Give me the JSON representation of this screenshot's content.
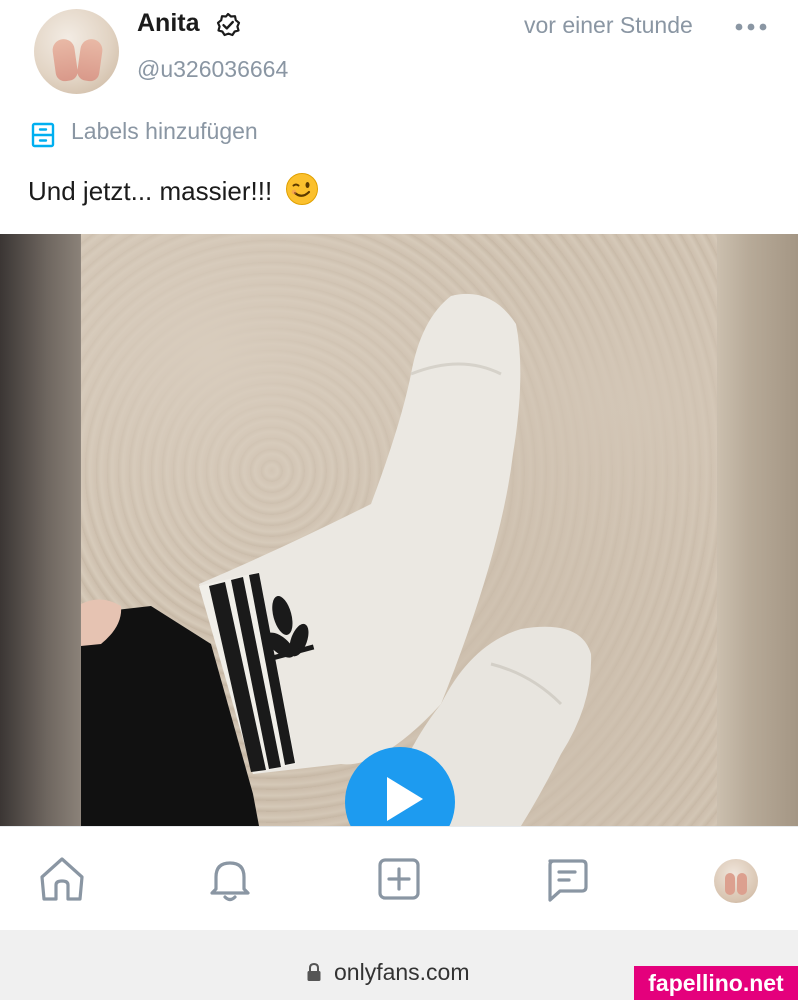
{
  "post": {
    "author": {
      "name": "Anita",
      "handle": "@u326036664",
      "verified_icon": "verified-badge-icon"
    },
    "timestamp": "vor einer Stunde",
    "more_icon": "more-horizontal-icon",
    "labels": {
      "icon": "label-icon",
      "text": "Labels hinzufügen"
    },
    "caption": "Und jetzt... massier!!!",
    "caption_emoji": "winking-face-emoji",
    "media": {
      "type": "video",
      "play_icon": "play-icon"
    }
  },
  "bottom_nav": {
    "items": [
      {
        "name": "home",
        "icon": "home-icon"
      },
      {
        "name": "notifications",
        "icon": "bell-icon"
      },
      {
        "name": "new-post",
        "icon": "add-square-icon"
      },
      {
        "name": "messages",
        "icon": "chat-icon"
      },
      {
        "name": "profile",
        "icon": "avatar"
      }
    ]
  },
  "browser": {
    "url": "onlyfans.com",
    "secure_icon": "lock-icon"
  },
  "watermark": "fapellino.net",
  "colors": {
    "accent": "#1d9bf0",
    "label_accent": "#00aff0",
    "muted_text": "#8a96a3",
    "watermark_bg": "#e4007c"
  }
}
